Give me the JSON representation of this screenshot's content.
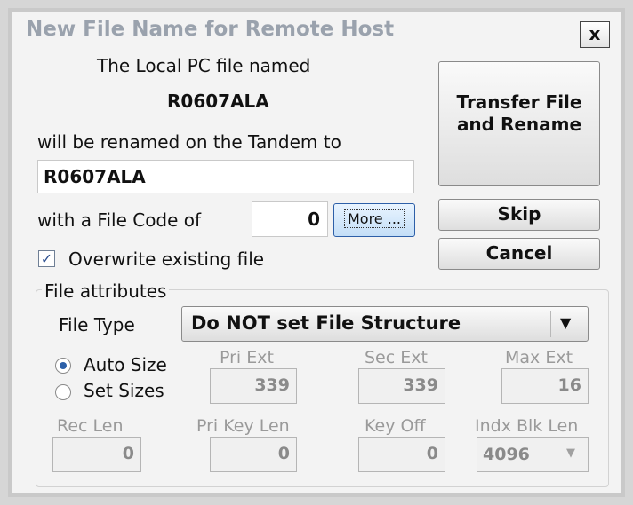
{
  "dialog": {
    "title": "New File Name for Remote Host",
    "close_label": "x",
    "local_line": "The Local PC file named",
    "local_file_name": "R0607ALA",
    "rename_line": "will be renamed on the Tandem to",
    "new_name_value": "R0607ALA",
    "file_code_label": "with a File Code of",
    "file_code_value": "0",
    "more_label": "More ...",
    "overwrite_label": "Overwrite existing file",
    "overwrite_checked": true,
    "buttons": {
      "transfer": "Transfer File and Rename",
      "skip": "Skip",
      "cancel": "Cancel"
    },
    "attributes": {
      "group_label": "File attributes",
      "file_type_label": "File Type",
      "file_type_value": "Do NOT set File Structure",
      "auto_size_label": "Auto Size",
      "set_sizes_label": "Set Sizes",
      "selected_size_option": "Auto Size",
      "pri_ext_label": "Pri Ext",
      "pri_ext_value": "339",
      "sec_ext_label": "Sec Ext",
      "sec_ext_value": "339",
      "max_ext_label": "Max Ext",
      "max_ext_value": "16",
      "rec_len_label": "Rec Len",
      "rec_len_value": "0",
      "pri_key_len_label": "Pri Key Len",
      "pri_key_len_value": "0",
      "key_off_label": "Key Off",
      "key_off_value": "0",
      "indx_blk_len_label": "Indx Blk Len",
      "indx_blk_len_value": "4096"
    }
  }
}
